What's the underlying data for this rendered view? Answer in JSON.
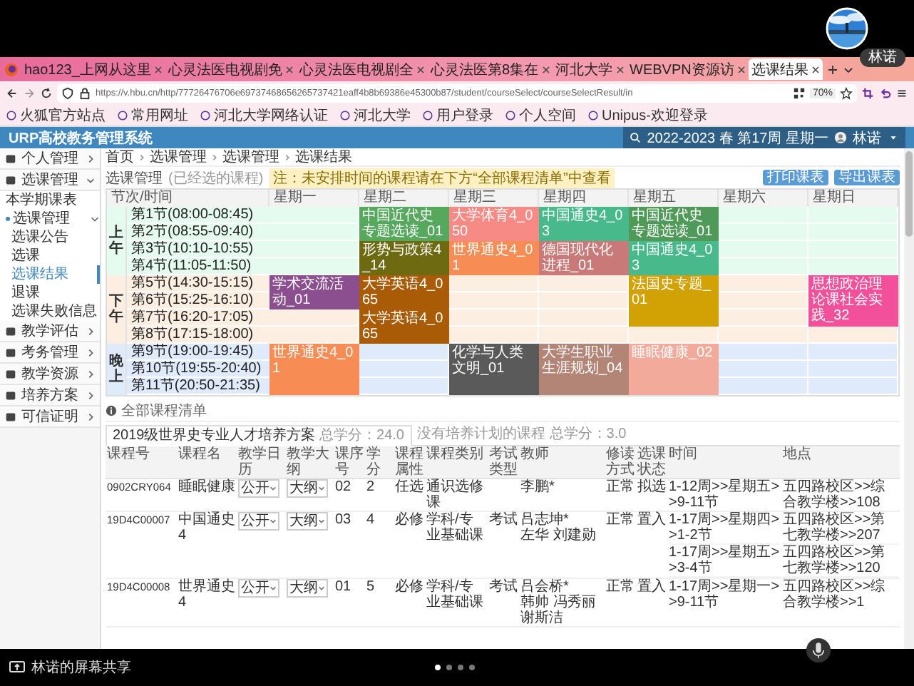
{
  "meeting": {
    "presenter": "林诺",
    "share_label": "林诺的屏幕共享",
    "pages": [
      {
        "selected": true
      },
      {
        "selected": false
      },
      {
        "selected": false
      },
      {
        "selected": false
      }
    ]
  },
  "browser": {
    "tabs": [
      {
        "label": "hao123_上网从这里",
        "selected": false
      },
      {
        "label": "心灵法医电视剧免",
        "selected": false
      },
      {
        "label": "心灵法医电视剧全",
        "selected": false
      },
      {
        "label": "心灵法医第8集在",
        "selected": false
      },
      {
        "label": "河北大学",
        "selected": false
      },
      {
        "label": "WEBVPN资源访",
        "selected": false
      },
      {
        "label": "选课结果",
        "selected": true
      }
    ],
    "url": "https://v.hbu.cn/http/77726476706e69737468656265737421eaff4b8b69386e45300b87/student/courseSelect/courseSelectResult/in",
    "zoom": "70%",
    "bookmarks": [
      "火狐官方站点",
      "常用网址",
      "河北大学网络认证",
      "河北大学",
      "用户登录",
      "个人空间",
      "Unipus-欢迎登录"
    ]
  },
  "app": {
    "title": "URP高校教务管理系统",
    "term": "2022-2023 春 第17周 星期一",
    "user": "林诺",
    "breadcrumb": [
      "首页",
      "选课管理",
      "选课管理",
      "选课结果"
    ],
    "page_title": "选课管理",
    "page_subtitle": "(已经选的课程)",
    "notice": "注：未安排时间的课程请在下方“全部课程清单”中查看",
    "actions": [
      "打印课表",
      "导出课表"
    ]
  },
  "sidebar": {
    "items": [
      {
        "label": "个人管理",
        "expanded": false
      },
      {
        "label": "选课管理",
        "expanded": true,
        "children": [
          {
            "label": "本学期课表",
            "selected": false
          },
          {
            "label": "选课管理",
            "expanded": true,
            "children": [
              {
                "label": "选课公告",
                "selected": false
              },
              {
                "label": "选课",
                "selected": false
              },
              {
                "label": "选课结果",
                "selected": true
              },
              {
                "label": "退课",
                "selected": false
              },
              {
                "label": "选课失败信息",
                "selected": false
              }
            ]
          }
        ]
      },
      {
        "label": "教学评估",
        "expanded": false
      },
      {
        "label": "考务管理",
        "expanded": false
      },
      {
        "label": "教学资源",
        "expanded": false
      },
      {
        "label": "培养方案",
        "expanded": false
      },
      {
        "label": "可信证明",
        "expanded": false
      }
    ]
  },
  "timetable": {
    "corner": "节次/时间",
    "days": [
      "星期一",
      "星期二",
      "星期三",
      "星期四",
      "星期五",
      "星期六",
      "星期日"
    ],
    "sections": [
      {
        "label": "上午",
        "color": "#e5fbef",
        "rows": [
          {
            "label": "第1节(08:00-08:45)",
            "cells": [
              {
                "kind": "empty"
              },
              {
                "kind": "course",
                "name": "中国近代史专题选读_01",
                "color": "#55a85c"
              },
              {
                "kind": "course",
                "name": "大学体育4_050",
                "color": "#f78a84"
              },
              {
                "kind": "course",
                "name": "中国通史4_03",
                "color": "#47b98b"
              },
              {
                "kind": "course",
                "name": "中国近代史专题选读_01",
                "color": "#4f9a58"
              },
              {
                "kind": "empty"
              },
              {
                "kind": "empty"
              }
            ]
          },
          {
            "label": "第2节(08:55-09:40)",
            "cells": [
              {
                "kind": "empty"
              },
              {
                "kind": "covered"
              },
              {
                "kind": "covered"
              },
              {
                "kind": "covered"
              },
              {
                "kind": "covered"
              },
              {
                "kind": "empty"
              },
              {
                "kind": "empty"
              }
            ]
          },
          {
            "label": "第3节(10:10-10:55)",
            "cells": [
              {
                "kind": "empty"
              },
              {
                "kind": "course",
                "name": "形势与政策4_14",
                "color": "#6e6a12"
              },
              {
                "kind": "course",
                "name": "世界通史4_01",
                "color": "#f78c55"
              },
              {
                "kind": "course",
                "name": "德国现代化进程_01",
                "color": "#c97a78"
              },
              {
                "kind": "course",
                "name": "中国通史4_03",
                "color": "#47b98b"
              },
              {
                "kind": "empty"
              },
              {
                "kind": "empty"
              }
            ]
          },
          {
            "label": "第4节(11:05-11:50)",
            "cells": [
              {
                "kind": "empty"
              },
              {
                "kind": "covered"
              },
              {
                "kind": "covered"
              },
              {
                "kind": "covered"
              },
              {
                "kind": "covered"
              },
              {
                "kind": "empty"
              },
              {
                "kind": "empty"
              }
            ]
          }
        ]
      },
      {
        "label": "下午",
        "color": "#fdeee2",
        "rows": [
          {
            "label": "第5节(14:30-15:15)",
            "cells": [
              {
                "kind": "course",
                "name": "学术交流活动_01",
                "color": "#8b4f90"
              },
              {
                "kind": "course",
                "name": "大学英语4_065",
                "color": "#a95b05"
              },
              {
                "kind": "empty"
              },
              {
                "kind": "empty"
              },
              {
                "kind": "course",
                "name": "法国史专题_01",
                "color": "#d2a204"
              },
              {
                "kind": "empty"
              },
              {
                "kind": "course",
                "name": "思想政治理论课社会实践_32",
                "color": "#f2509a"
              }
            ]
          },
          {
            "label": "第6节(15:25-16:10)",
            "cells": [
              {
                "kind": "covered"
              },
              {
                "kind": "covered"
              },
              {
                "kind": "empty"
              },
              {
                "kind": "empty"
              },
              {
                "kind": "covered"
              },
              {
                "kind": "empty"
              },
              {
                "kind": "covered"
              }
            ]
          },
          {
            "label": "第7节(16:20-17:05)",
            "cells": [
              {
                "kind": "empty"
              },
              {
                "kind": "course",
                "name": "大学英语4_065",
                "color": "#a95b05"
              },
              {
                "kind": "empty"
              },
              {
                "kind": "empty"
              },
              {
                "kind": "covered"
              },
              {
                "kind": "empty"
              },
              {
                "kind": "covered"
              }
            ]
          },
          {
            "label": "第8节(17:15-18:00)",
            "cells": [
              {
                "kind": "empty"
              },
              {
                "kind": "covered"
              },
              {
                "kind": "empty"
              },
              {
                "kind": "empty"
              },
              {
                "kind": "empty"
              },
              {
                "kind": "empty"
              },
              {
                "kind": "empty"
              }
            ]
          }
        ]
      },
      {
        "label": "晚上",
        "color": "#dfeafb",
        "rows": [
          {
            "label": "第9节(19:00-19:45)",
            "cells": [
              {
                "kind": "course",
                "name": "世界通史4_01",
                "color": "#f78c55"
              },
              {
                "kind": "empty"
              },
              {
                "kind": "course",
                "name": "化学与人类文明_01",
                "color": "#5a5a5a"
              },
              {
                "kind": "course",
                "name": "大学生职业生涯规划_04",
                "color": "#b38576"
              },
              {
                "kind": "course",
                "name": "睡眠健康_02",
                "color": "#f2aa9a"
              },
              {
                "kind": "empty"
              },
              {
                "kind": "empty"
              }
            ]
          },
          {
            "label": "第10节(19:55-20:40)",
            "cells": [
              {
                "kind": "covered"
              },
              {
                "kind": "empty"
              },
              {
                "kind": "covered"
              },
              {
                "kind": "covered"
              },
              {
                "kind": "covered"
              },
              {
                "kind": "empty"
              },
              {
                "kind": "empty"
              }
            ]
          },
          {
            "label": "第11节(20:50-21:35)",
            "cells": [
              {
                "kind": "covered"
              },
              {
                "kind": "empty"
              },
              {
                "kind": "covered"
              },
              {
                "kind": "covered"
              },
              {
                "kind": "covered"
              },
              {
                "kind": "empty"
              },
              {
                "kind": "empty"
              }
            ]
          }
        ]
      }
    ]
  },
  "course_list": {
    "title": "全部课程清单",
    "tabs": [
      {
        "label": "2019级世界史专业人才培养方案",
        "credits": "总学分：24.0",
        "selected": true
      },
      {
        "label": "没有培养计划的课程",
        "credits": "总学分：3.0",
        "selected": false
      }
    ],
    "columns": [
      "课程号",
      "课程名",
      "教学日历",
      "教学大纲",
      "课序号",
      "学分",
      "课程属性",
      "课程类别",
      "考试类型",
      "教师",
      "修读方式",
      "选课状态",
      "时间",
      "地点"
    ],
    "rows": [
      {
        "cells": [
          {
            "kind": "text",
            "text": "0902CRY064"
          },
          {
            "kind": "text",
            "text": "睡眠健康"
          },
          {
            "kind": "select",
            "value": "公开"
          },
          {
            "kind": "select",
            "value": "大纲"
          },
          {
            "kind": "text",
            "text": "02"
          },
          {
            "kind": "text",
            "text": "2"
          },
          {
            "kind": "text",
            "text": "任选"
          },
          {
            "kind": "text",
            "text": "通识选修课"
          },
          {
            "kind": "blank"
          },
          {
            "kind": "text",
            "text": "李鹏*"
          },
          {
            "kind": "text",
            "text": "正常"
          },
          {
            "kind": "text",
            "text": "拟选"
          },
          {
            "kind": "text",
            "text": "1-12周>>星期五>>9-11节"
          },
          {
            "kind": "text",
            "text": "五四路校区>>综合教学楼>>108"
          }
        ]
      },
      {
        "cells": [
          {
            "kind": "text",
            "text": "19D4C00007"
          },
          {
            "kind": "text",
            "text": "中国通史4"
          },
          {
            "kind": "select",
            "value": "公开"
          },
          {
            "kind": "select",
            "value": "大纲"
          },
          {
            "kind": "text",
            "text": "03"
          },
          {
            "kind": "text",
            "text": "4"
          },
          {
            "kind": "text",
            "text": "必修"
          },
          {
            "kind": "text",
            "text": "学科/专业基础课"
          },
          {
            "kind": "text",
            "text": "考试"
          },
          {
            "kind": "names",
            "names": [
              "吕志坤*",
              "左华",
              "刘建勋"
            ]
          },
          {
            "kind": "text",
            "text": "正常"
          },
          {
            "kind": "text",
            "text": "置入"
          },
          {
            "kind": "lines",
            "lines": [
              "1-17周>>星期四>>1-2节",
              "1-17周>>星期五>>3-4节"
            ]
          },
          {
            "kind": "lines",
            "lines": [
              "五四路校区>>第七教学楼>>207",
              "五四路校区>>第七教学楼>>120"
            ]
          }
        ]
      },
      {
        "cells": [
          {
            "kind": "text",
            "text": "19D4C00008"
          },
          {
            "kind": "text",
            "text": "世界通史4"
          },
          {
            "kind": "select",
            "value": "公开"
          },
          {
            "kind": "select",
            "value": "大纲"
          },
          {
            "kind": "text",
            "text": "01"
          },
          {
            "kind": "text",
            "text": "5"
          },
          {
            "kind": "text",
            "text": "必修"
          },
          {
            "kind": "text",
            "text": "学科/专业基础课"
          },
          {
            "kind": "text",
            "text": "考试"
          },
          {
            "kind": "names",
            "names": [
              "吕会桥*",
              "韩帅",
              "冯秀丽",
              "谢斯洁"
            ]
          },
          {
            "kind": "text",
            "text": "正常"
          },
          {
            "kind": "text",
            "text": "置入"
          },
          {
            "kind": "text",
            "text": "1-17周>>星期一>>9-11节"
          },
          {
            "kind": "text",
            "text": "五四路校区>>综合教学楼>>1"
          }
        ]
      }
    ]
  }
}
